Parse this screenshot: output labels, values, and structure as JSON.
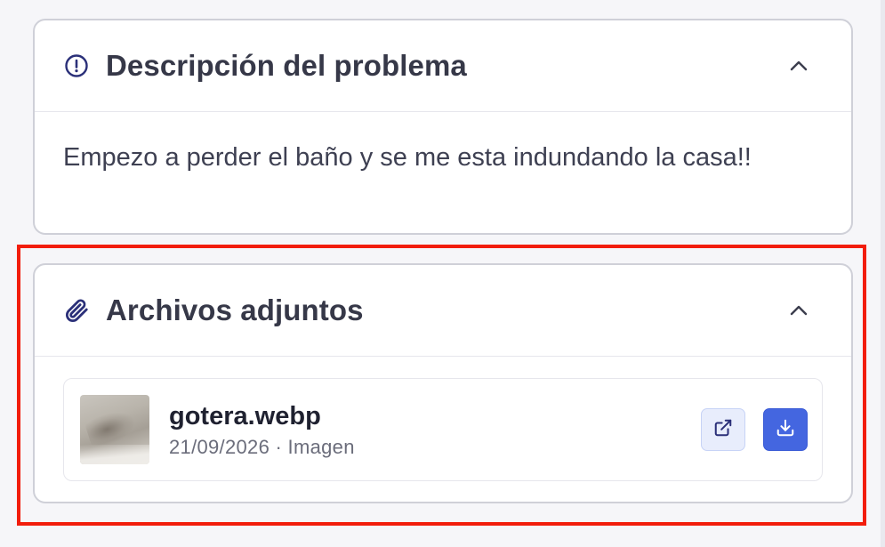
{
  "description_card": {
    "title": "Descripción del problema",
    "icon": "alert-circle-icon",
    "text": "Empezo a perder el baño y se me esta indundando la casa!!",
    "expanded": true
  },
  "attachments_card": {
    "title": "Archivos adjuntos",
    "icon": "paperclip-icon",
    "expanded": true,
    "files": [
      {
        "name": "gotera.webp",
        "date": "21/09/2026",
        "type": "Imagen",
        "meta": "21/09/2026 · Imagen",
        "thumbnail": "image-thumbnail",
        "actions": [
          "external-link-icon",
          "download-icon"
        ]
      }
    ]
  },
  "colors": {
    "accent": "#4466e0",
    "accent_light": "#e8edfc",
    "highlight": "#f21d0c",
    "icon": "#2b3079",
    "card_border": "#cfd0d8"
  }
}
